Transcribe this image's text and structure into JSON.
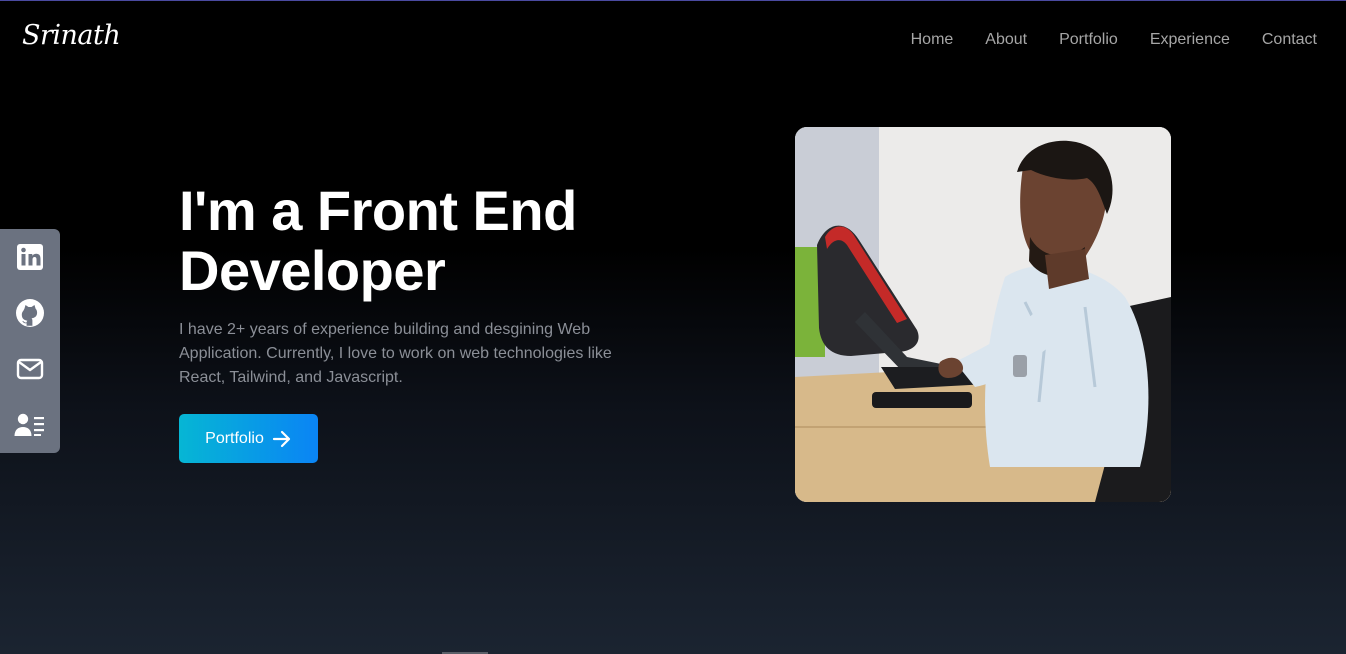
{
  "brand": {
    "logo_text": "Srinath"
  },
  "nav": {
    "items": [
      {
        "label": "Home"
      },
      {
        "label": "About"
      },
      {
        "label": "Portfolio"
      },
      {
        "label": "Experience"
      },
      {
        "label": "Contact"
      }
    ]
  },
  "social": {
    "items": [
      {
        "icon": "linkedin-icon"
      },
      {
        "icon": "github-icon"
      },
      {
        "icon": "mail-icon"
      },
      {
        "icon": "resume-icon"
      }
    ]
  },
  "hero": {
    "title_line1": "I'm a Front End",
    "title_line2": "Developer",
    "description": "I have 2+ years of experience building and desgining Web Application. Currently, I love to work on web technologies like React, Tailwind, and Javascript.",
    "cta_label": "Portfolio",
    "cta_icon": "arrow-right-icon"
  },
  "photo": {
    "subject": "profile-photo"
  },
  "colors": {
    "accent_start": "#06b6d4",
    "accent_end": "#0a84f5",
    "sidebar": "#6b7280",
    "nav_text": "#a6a6a6",
    "body_text": "#8b8f97"
  }
}
